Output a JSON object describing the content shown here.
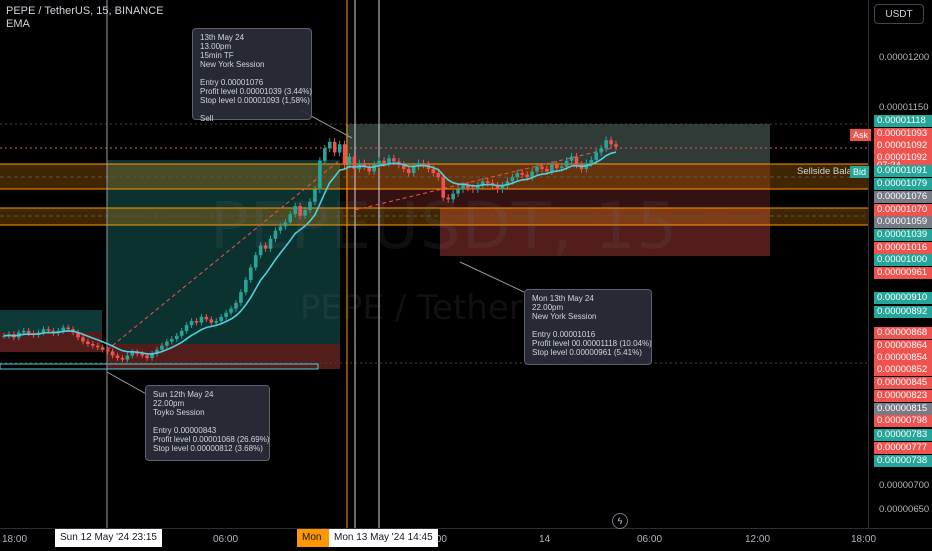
{
  "header": {
    "symbol_line": "PEPE / TetherUS, 15, BINANCE",
    "indicator": "EMA"
  },
  "watermark": {
    "big": "PEPEUSDT, 15",
    "small": "PEPE / Tether"
  },
  "currency_button": "USDT",
  "price_axis": [
    {
      "text": "0.00001200",
      "kind": "tick"
    },
    {
      "text": "0.00001150",
      "kind": "tick"
    },
    {
      "text": "0.00001118",
      "kind": "teal"
    },
    {
      "text": "0.00001093",
      "kind": "red"
    },
    {
      "text": "0.00001092",
      "kind": "red"
    },
    {
      "text": "0.00001092",
      "kind": "red"
    },
    {
      "text": "07:24",
      "kind": "red"
    },
    {
      "text": "0.00001091",
      "kind": "teal"
    },
    {
      "text": "0.00001079",
      "kind": "teal"
    },
    {
      "text": "0.00001076",
      "kind": "gray"
    },
    {
      "text": "0.00001070",
      "kind": "red"
    },
    {
      "text": "0.00001059",
      "kind": "gray"
    },
    {
      "text": "0.00001039",
      "kind": "teal"
    },
    {
      "text": "0.00001016",
      "kind": "red"
    },
    {
      "text": "0.00001000",
      "kind": "teal"
    },
    {
      "text": "0.00000961",
      "kind": "red"
    },
    {
      "text": "0.00000910",
      "kind": "teal"
    },
    {
      "text": "0.00000892",
      "kind": "teal"
    },
    {
      "text": "0.00000868",
      "kind": "red"
    },
    {
      "text": "0.00000864",
      "kind": "red"
    },
    {
      "text": "0.00000854",
      "kind": "red"
    },
    {
      "text": "0.00000852",
      "kind": "red"
    },
    {
      "text": "0.00000845",
      "kind": "red"
    },
    {
      "text": "0.00000823",
      "kind": "red"
    },
    {
      "text": "0.00000815",
      "kind": "gray"
    },
    {
      "text": "0.00000798",
      "kind": "red"
    },
    {
      "text": "0.00000783",
      "kind": "teal"
    },
    {
      "text": "0.00000777",
      "kind": "red"
    },
    {
      "text": "0.00000738",
      "kind": "teal"
    },
    {
      "text": "0.00000700",
      "kind": "tick"
    },
    {
      "text": "0.00000650",
      "kind": "tick"
    }
  ],
  "ask_label": "Ask",
  "bid_label": "Bid",
  "sellside_label": "Sellside Balance",
  "time_axis": {
    "labels": [
      "18:00",
      "06:00",
      "12:00",
      "14",
      "06:00",
      "12:00",
      "18:00"
    ],
    "cursor_left": "Sun 12 May '24   23:15",
    "cursor_mid_tag": "Mon",
    "cursor_mid": "Mon 13 May '24   14:45",
    "partial": ":00"
  },
  "notes": {
    "top": [
      "13th May 24",
      "13.00pm",
      "15min TF",
      "New York Session",
      "",
      "Entry 0.00001076",
      "Profit level 0.00001039 (3.44%)",
      "Stop level 0.00001093 (1,58%)",
      "",
      "Sell"
    ],
    "left": [
      "Sun 12th May 24",
      "22.00pm",
      "Toyko Session",
      "",
      "Entry 0.00000843",
      "Profit level 0.00001068 (26.69%)",
      "Stop level 0.00000812 (3.68%)"
    ],
    "right": [
      "Mon 13th May 24",
      "22.00pm",
      "New York Session",
      "",
      "Entry 0.00001016",
      "Profit level 00.00001118 (10.04%)",
      "Stop level 0.00000961 (5.41%)"
    ]
  },
  "colors": {
    "up": "#26a69a",
    "down": "#ef5350",
    "ema": "#4dd0e1",
    "orange": "#ff9800",
    "bg": "#000000"
  },
  "chart_data": {
    "type": "candlestick",
    "price_range": [
      6.3e-06,
      1.24e-05
    ],
    "candles_note": "approximate reconstruction",
    "closes": [
      8.62e-06,
      8.64e-06,
      8.6e-06,
      8.66e-06,
      8.68e-06,
      8.65e-06,
      8.63e-06,
      8.66e-06,
      8.7e-06,
      8.68e-06,
      8.65e-06,
      8.68e-06,
      8.72e-06,
      8.7e-06,
      8.66e-06,
      8.6e-06,
      8.55e-06,
      8.52e-06,
      8.5e-06,
      8.48e-06,
      8.45e-06,
      8.43e-06,
      8.38e-06,
      8.35e-06,
      8.33e-06,
      8.38e-06,
      8.42e-06,
      8.4e-06,
      8.38e-06,
      8.35e-06,
      8.4e-06,
      8.45e-06,
      8.5e-06,
      8.55e-06,
      8.58e-06,
      8.62e-06,
      8.68e-06,
      8.75e-06,
      8.8e-06,
      8.78e-06,
      8.85e-06,
      8.82e-06,
      8.78e-06,
      8.8e-06,
      8.85e-06,
      8.9e-06,
      8.95e-06,
      9.02e-06,
      9.15e-06,
      9.3e-06,
      9.45e-06,
      9.6e-06,
      9.72e-06,
      9.68e-06,
      9.8e-06,
      9.9e-06,
      9.95e-06,
      1e-05,
      1.01e-05,
      1.02e-05,
      1.008e-05,
      1.015e-05,
      1.025e-05,
      1.04e-05,
      1.075e-05,
      1.09e-05,
      1.098e-05,
      1.085e-05,
      1.095e-05,
      1.07e-05,
      1.08e-05,
      1.065e-05,
      1.072e-05,
      1.068e-05,
      1.062e-05,
      1.07e-05,
      1.075e-05,
      1.072e-05,
      1.078e-05,
      1.074e-05,
      1.07e-05,
      1.065e-05,
      1.06e-05,
      1.068e-05,
      1.072e-05,
      1.07e-05,
      1.065e-05,
      1.06e-05,
      1.055e-05,
      1.03e-05,
      1.028e-05,
      1.035e-05,
      1.04e-05,
      1.045e-05,
      1.042e-05,
      1.04e-05,
      1.045e-05,
      1.05e-05,
      1.048e-05,
      1.045e-05,
      1.04e-05,
      1.045e-05,
      1.05e-05,
      1.055e-05,
      1.06e-05,
      1.058e-05,
      1.055e-05,
      1.062e-05,
      1.068e-05,
      1.065e-05,
      1.062e-05,
      1.07e-05,
      1.066e-05,
      1.068e-05,
      1.075e-05,
      1.08e-05,
      1.07e-05,
      1.065e-05,
      1.072e-05,
      1.076e-05,
      1.085e-05,
      1.09e-05,
      1.1e-05,
      1.095e-05,
      1.092e-05
    ]
  }
}
